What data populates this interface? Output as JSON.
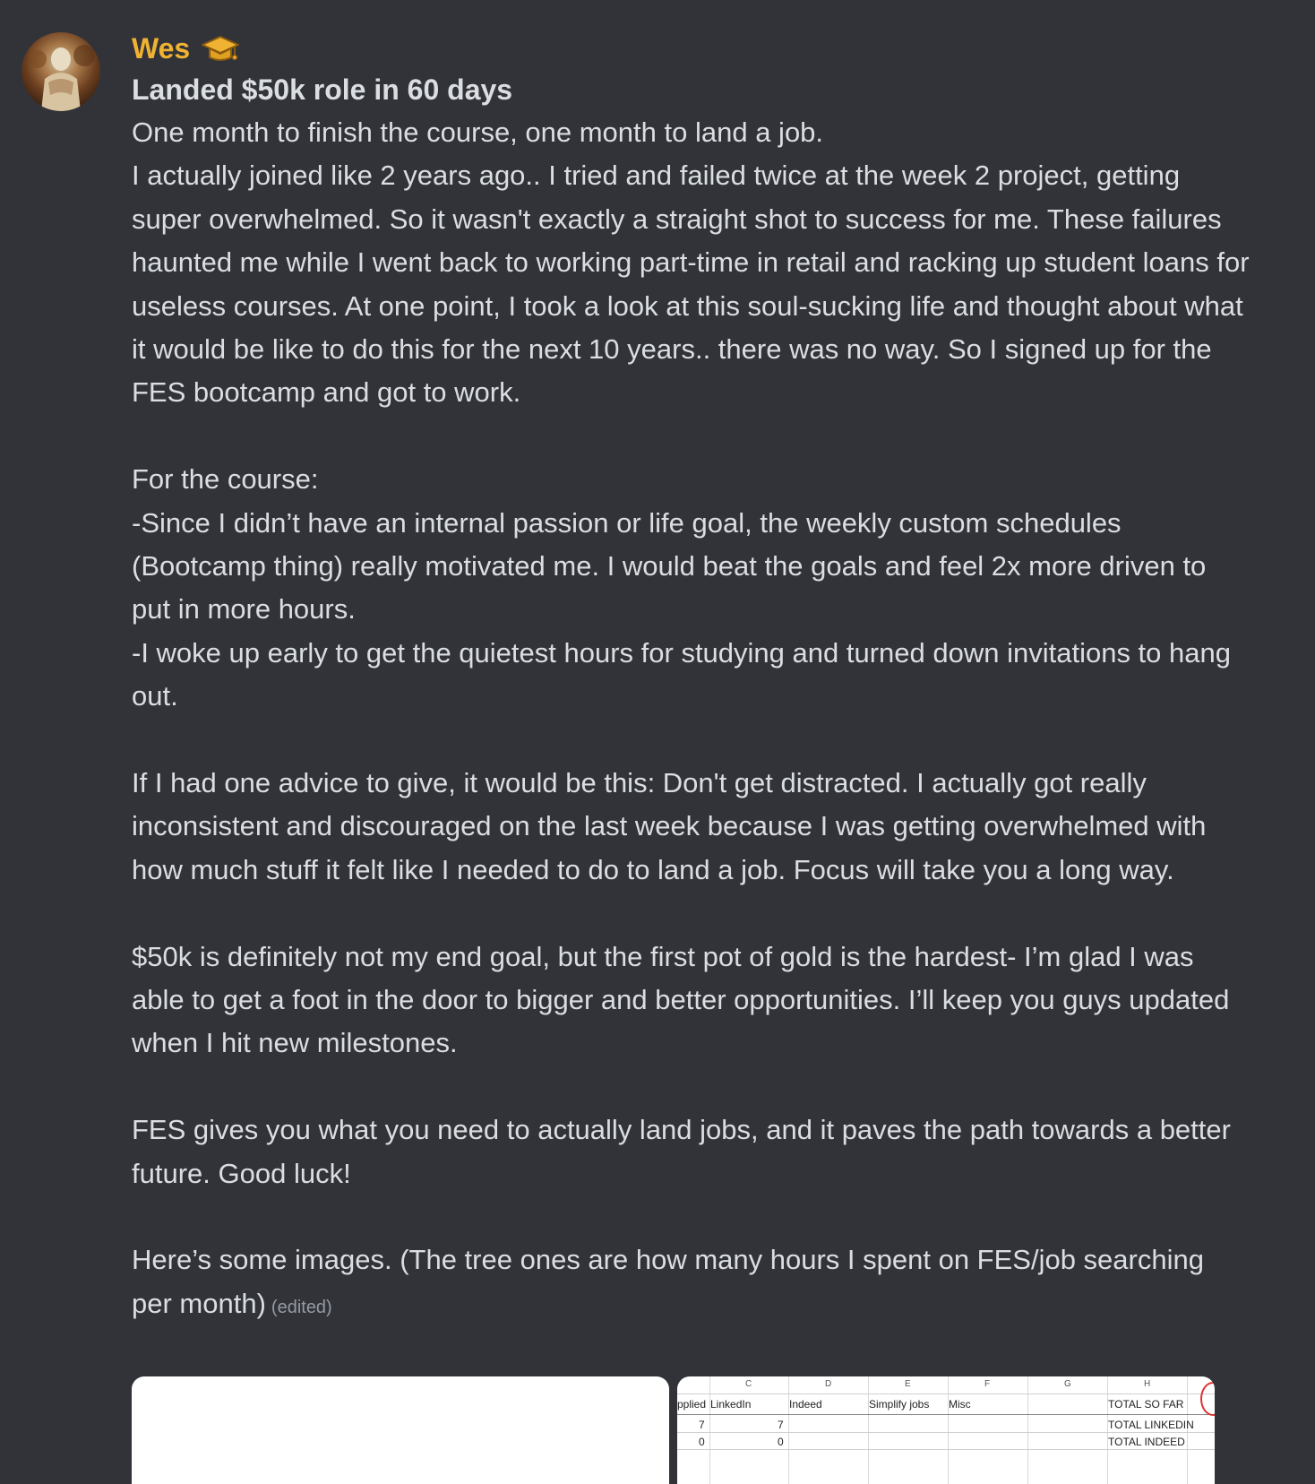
{
  "message": {
    "author": "Wes",
    "author_badge_icon": "graduation-cap-icon",
    "title": "Landed $50k role in 60 days",
    "paragraphs": [
      "One month to finish the course, one month to land a job.\nI actually joined like 2 years ago.. I tried and failed twice at the week 2 project, getting super overwhelmed. So it wasn't exactly a straight shot to success for me. These failures haunted me while I went back to working part-time in retail and racking up student loans for useless courses. At one point, I took a look at this soul-sucking life and thought about what it would be like to do this for the next 10 years.. there was no way. So I signed up for the FES bootcamp and got to work.",
      "For the course:\n-Since I didn’t have an internal passion or life goal, the weekly custom schedules (Bootcamp thing) really motivated me. I would beat the goals and feel 2x more driven to put in more hours.\n-I woke up early to get the quietest hours for studying and turned down invitations to hang out.",
      "If I had one advice to give, it would be this: Don't get distracted. I actually got really inconsistent and discouraged on the last week because I was getting overwhelmed with how much stuff it felt like I needed to do to land a job. Focus will take you a long way.",
      "$50k is definitely not my end goal, but the first pot of gold is the hardest- I’m glad I was able to get a foot in the door to bigger and better opportunities. I’ll keep you guys updated when I hit new milestones.",
      "FES gives you what you need to actually land jobs, and it paves the path towards a better future. Good luck!",
      "Here’s some images. (The tree ones are how many hours I spent on FES/job searching per month)"
    ],
    "edited_label": "(edited)"
  },
  "spreadsheet": {
    "column_letters": [
      "C",
      "D",
      "E",
      "F",
      "G",
      "H"
    ],
    "headers": [
      "pplied",
      "LinkedIn",
      "Indeed",
      "Simplify jobs",
      "Misc",
      "TOTAL SO FAR"
    ],
    "rows": [
      {
        "a": "7",
        "b": "7",
        "label": "TOTAL LINKEDIN"
      },
      {
        "a": "0",
        "b": "0",
        "label": "TOTAL INDEED"
      }
    ]
  },
  "colors": {
    "background": "#313338",
    "username": "#f0b232",
    "text": "#dbdee1",
    "muted": "#949ba4"
  }
}
